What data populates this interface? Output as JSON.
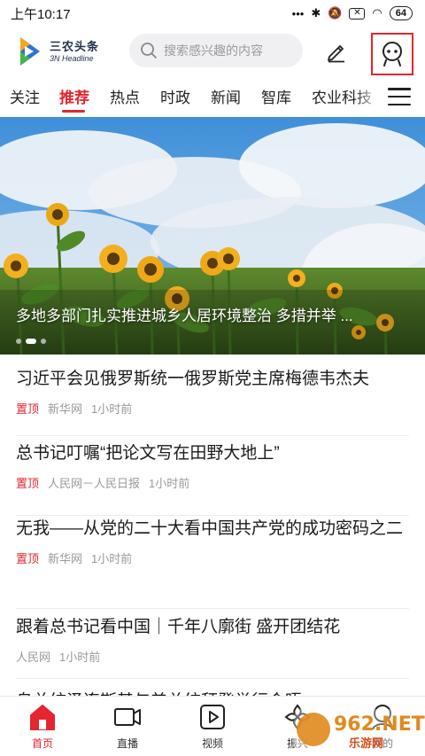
{
  "status_bar": {
    "time": "上午10:17",
    "battery": "64"
  },
  "header": {
    "logo_cn": "三农头条",
    "logo_en": "3N Headline",
    "search_placeholder": "搜索感兴趣的内容"
  },
  "tabs": [
    {
      "label": "关注"
    },
    {
      "label": "推荐",
      "active": true
    },
    {
      "label": "热点"
    },
    {
      "label": "时政"
    },
    {
      "label": "新闻"
    },
    {
      "label": "智库"
    },
    {
      "label": "农业科技"
    }
  ],
  "banner": {
    "caption": "多地多部门扎实推进城乡人居环境整治 多措并举 ..."
  },
  "news": [
    {
      "title": "习近平会见俄罗斯统一俄罗斯党主席梅德韦杰夫",
      "pin": "置顶",
      "source": "新华网",
      "time": "1小时前"
    },
    {
      "title": "总书记叮嘱“把论文写在田野大地上”",
      "pin": "置顶",
      "source": "人民网－人民日报",
      "time": "1小时前"
    },
    {
      "title": "无我——从党的二十大看中国共产党的成功密码之二",
      "pin": "置顶",
      "source": "新华网",
      "time": "1小时前"
    },
    {
      "title": "跟着总书记看中国｜千年八廓街 盛开团结花",
      "source": "人民网",
      "time": "1小时前"
    }
  ],
  "partial_title": "乌总统泽连斯基与美总统拜登举行会晤",
  "bottom_nav": [
    {
      "label": "首页",
      "active": true
    },
    {
      "label": "直播"
    },
    {
      "label": "视频"
    },
    {
      "label": "振兴"
    },
    {
      "label": "我的"
    }
  ],
  "watermark": {
    "text": "962.NET",
    "sub": "乐游网"
  },
  "colors": {
    "accent": "#e3262f",
    "text": "#222222",
    "meta": "#999999"
  }
}
